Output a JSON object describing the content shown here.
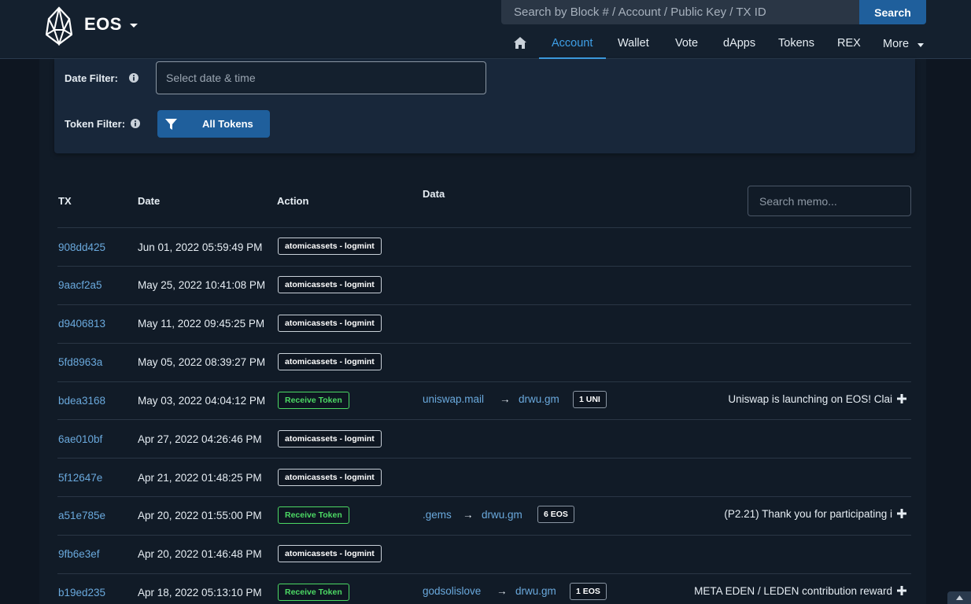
{
  "brand": {
    "name": "EOS"
  },
  "search": {
    "placeholder": "Search by Block # / Account / Public Key / TX ID",
    "button": "Search"
  },
  "nav": {
    "items": [
      "Account",
      "Wallet",
      "Vote",
      "dApps",
      "Tokens",
      "REX",
      "More"
    ],
    "active": "Account"
  },
  "filters": {
    "date_label": "Date Filter:",
    "date_placeholder": "Select date & time",
    "token_label": "Token Filter:",
    "token_button": "All Tokens"
  },
  "table": {
    "headers": {
      "tx": "TX",
      "date": "Date",
      "action": "Action",
      "data": "Data"
    },
    "memo_placeholder": "Search memo...",
    "rows": [
      {
        "tx": "908dd425",
        "date": "Jun 01, 2022 05:59:49 PM",
        "action": "atomicassets - logmint"
      },
      {
        "tx": "9aacf2a5",
        "date": "May 25, 2022 10:41:08 PM",
        "action": "atomicassets - logmint"
      },
      {
        "tx": "d9406813",
        "date": "May 11, 2022 09:45:25 PM",
        "action": "atomicassets - logmint"
      },
      {
        "tx": "5fd8963a",
        "date": "May 05, 2022 08:39:27 PM",
        "action": "atomicassets - logmint"
      },
      {
        "tx": "bdea3168",
        "date": "May 03, 2022 04:04:12 PM",
        "action": "Receive Token",
        "from": "uniswap.mail",
        "arrow": "→",
        "to": "drwu.gm",
        "amount": "1 UNI",
        "memo": "Uniswap is launching on EOS! Clai"
      },
      {
        "tx": "6ae010bf",
        "date": "Apr 27, 2022 04:26:46 PM",
        "action": "atomicassets - logmint"
      },
      {
        "tx": "5f12647e",
        "date": "Apr 21, 2022 01:48:25 PM",
        "action": "atomicassets - logmint"
      },
      {
        "tx": "a51e785e",
        "date": "Apr 20, 2022 01:55:00 PM",
        "action": "Receive Token",
        "from": ".gems",
        "arrow": "→",
        "to": "drwu.gm",
        "amount": "6 EOS",
        "memo": "(P2.21) Thank you for participating i"
      },
      {
        "tx": "9fb6e3ef",
        "date": "Apr 20, 2022 01:46:48 PM",
        "action": "atomicassets - logmint"
      },
      {
        "tx": "b19ed235",
        "date": "Apr 18, 2022 05:13:10 PM",
        "action": "Receive Token",
        "from": "godsolislove",
        "arrow": "→",
        "to": "drwu.gm",
        "amount": "1 EOS",
        "memo": "META EDEN / LEDEN contribution reward"
      }
    ]
  },
  "icons": {
    "logo": "eos-logo-icon",
    "home": "home-icon",
    "info": "info-icon",
    "filter": "filter-icon",
    "expand": "plus-icon",
    "scroll": "chevron-up-icon"
  },
  "colors": {
    "accent": "#3fa0e8",
    "button": "#1f5f9c",
    "link": "#6aa9dd",
    "receive": "#4cd964"
  }
}
